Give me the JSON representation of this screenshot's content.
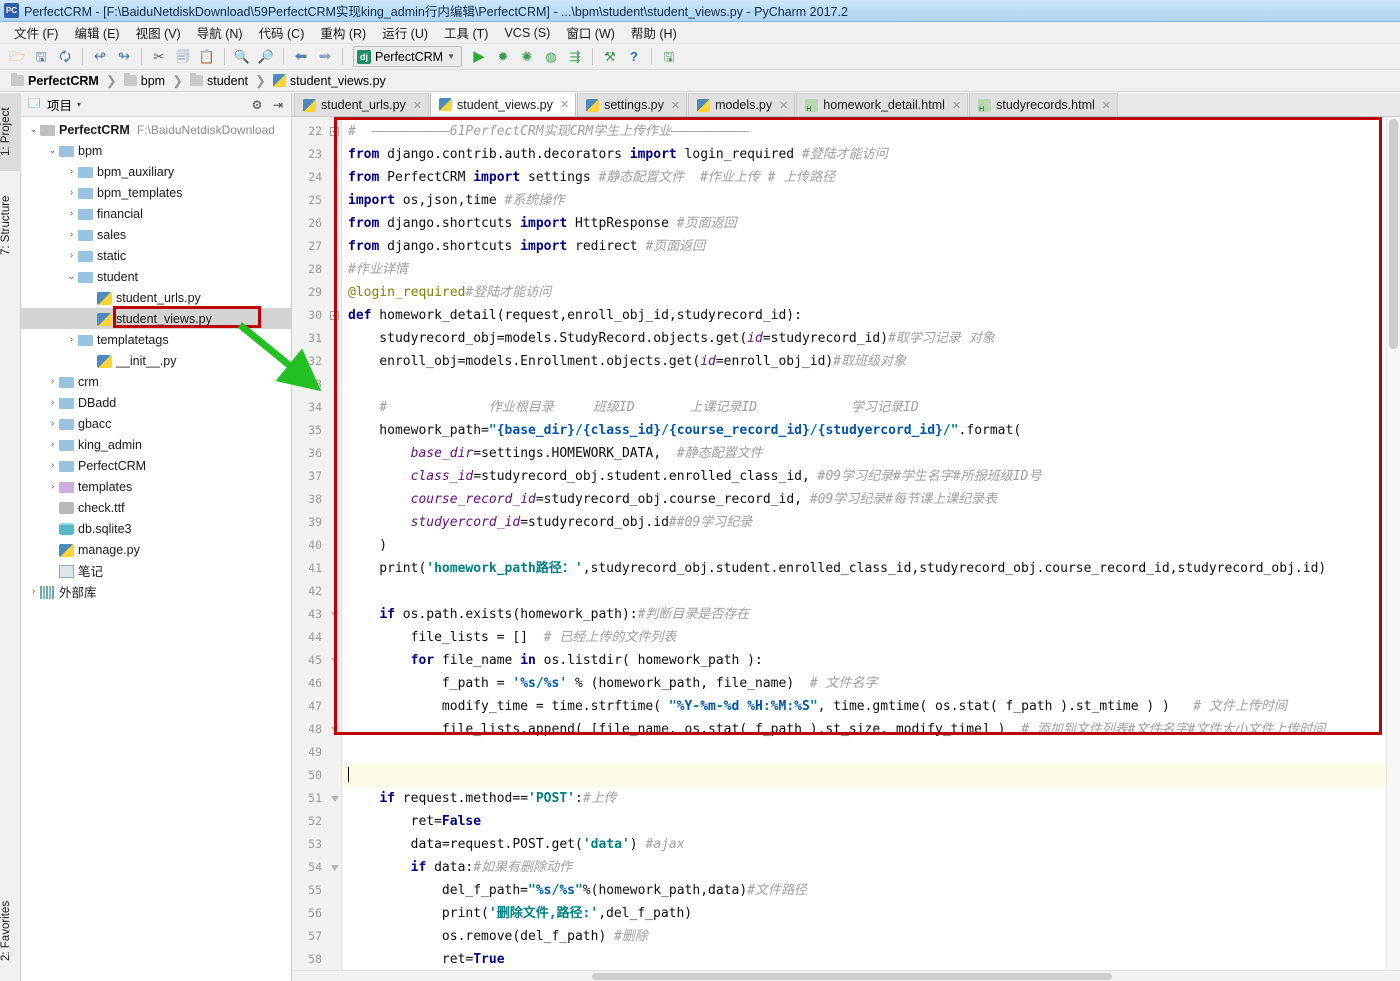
{
  "window": {
    "title": "PerfectCRM - [F:\\BaiduNetdiskDownload\\59PerfectCRM实现king_admin行内编辑\\PerfectCRM] - ...\\bpm\\student\\student_views.py - PyCharm 2017.2",
    "app_badge": "PC"
  },
  "menu": [
    {
      "label": "文件 (F)"
    },
    {
      "label": "编辑 (E)"
    },
    {
      "label": "视图 (V)"
    },
    {
      "label": "导航 (N)"
    },
    {
      "label": "代码 (C)"
    },
    {
      "label": "重构 (R)"
    },
    {
      "label": "运行 (U)"
    },
    {
      "label": "工具 (T)"
    },
    {
      "label": "VCS (S)"
    },
    {
      "label": "窗口 (W)"
    },
    {
      "label": "帮助 (H)"
    }
  ],
  "toolbar": {
    "icons": [
      {
        "name": "open-folder-icon",
        "glyph": "📂"
      },
      {
        "name": "save-all-icon",
        "glyph": "💾"
      },
      {
        "name": "sync-icon",
        "glyph": "🔄"
      },
      {
        "name": "undo-icon",
        "glyph": "↩"
      },
      {
        "name": "redo-icon",
        "glyph": "↪"
      },
      {
        "name": "cut-icon",
        "glyph": "✂"
      },
      {
        "name": "copy-icon",
        "glyph": "⧉"
      },
      {
        "name": "paste-icon",
        "glyph": "📋"
      },
      {
        "name": "find-icon",
        "glyph": "🔍"
      },
      {
        "name": "replace-icon",
        "glyph": "🔎"
      },
      {
        "name": "back-icon",
        "glyph": "⬅"
      },
      {
        "name": "forward-icon",
        "glyph": "➡"
      }
    ],
    "run_config": {
      "label": "PerfectCRM",
      "badge": "dj"
    },
    "run_icons": [
      {
        "name": "run-icon",
        "glyph": "▶",
        "color": "#2eaa37"
      },
      {
        "name": "debug-icon",
        "glyph": "✹",
        "color": "#3c9a4e"
      },
      {
        "name": "coverage-icon",
        "glyph": "✺",
        "color": "#3c9a4e"
      },
      {
        "name": "profile-icon",
        "glyph": "◉",
        "color": "#3c9a4e"
      },
      {
        "name": "attach-icon",
        "glyph": "⇥",
        "color": "#3c9a4e"
      }
    ],
    "extra_icons": [
      {
        "name": "settings-wrench-icon",
        "glyph": "⚒",
        "color": "#3c9a4e"
      },
      {
        "name": "help-icon",
        "glyph": "?",
        "color": "#2b6cb0"
      },
      {
        "name": "database-icon",
        "glyph": "🗄",
        "color": "#3c9a4e"
      }
    ]
  },
  "breadcrumb": [
    {
      "label": "PerfectCRM",
      "icon": "folder-icon",
      "bold": true
    },
    {
      "label": "bpm",
      "icon": "folder-icon",
      "bold": false
    },
    {
      "label": "student",
      "icon": "folder-icon",
      "bold": false
    },
    {
      "label": "student_views.py",
      "icon": "python-file-icon",
      "bold": false
    }
  ],
  "left_strip": [
    {
      "label": "1: Project",
      "active": true,
      "icon": "project-icon"
    },
    {
      "label": "7: Structure",
      "active": false,
      "icon": "structure-icon"
    },
    {
      "label": "2: Favorites",
      "active": false,
      "icon": "star-icon"
    }
  ],
  "project_panel": {
    "header": {
      "title": "项目",
      "dropdown": "▾",
      "gear": "⚙",
      "collapse": "⇥"
    },
    "tree": [
      {
        "depth": 0,
        "arrow": "v",
        "icon": "folder-icon",
        "label": "PerfectCRM",
        "bold": true,
        "path": "F:\\BaiduNetdiskDownload",
        "selected": false
      },
      {
        "depth": 1,
        "arrow": "v",
        "icon": "module-folder-icon",
        "label": "bpm",
        "bold": false,
        "path": "",
        "selected": false
      },
      {
        "depth": 2,
        "arrow": ">",
        "icon": "module-folder-icon",
        "label": "bpm_auxiliary",
        "bold": false,
        "path": "",
        "selected": false
      },
      {
        "depth": 2,
        "arrow": ">",
        "icon": "module-folder-icon",
        "label": "bpm_templates",
        "bold": false,
        "path": "",
        "selected": false
      },
      {
        "depth": 2,
        "arrow": ">",
        "icon": "module-folder-icon",
        "label": "financial",
        "bold": false,
        "path": "",
        "selected": false
      },
      {
        "depth": 2,
        "arrow": ">",
        "icon": "module-folder-icon",
        "label": "sales",
        "bold": false,
        "path": "",
        "selected": false
      },
      {
        "depth": 2,
        "arrow": ">",
        "icon": "module-folder-icon",
        "label": "static",
        "bold": false,
        "path": "",
        "selected": false
      },
      {
        "depth": 2,
        "arrow": "v",
        "icon": "module-folder-icon",
        "label": "student",
        "bold": false,
        "path": "",
        "selected": false
      },
      {
        "depth": 3,
        "arrow": "",
        "icon": "python-file-icon",
        "label": "student_urls.py",
        "bold": false,
        "path": "",
        "selected": false
      },
      {
        "depth": 3,
        "arrow": "",
        "icon": "python-file-icon",
        "label": "student_views.py",
        "bold": false,
        "path": "",
        "selected": true
      },
      {
        "depth": 2,
        "arrow": ">",
        "icon": "module-folder-icon",
        "label": "templatetags",
        "bold": false,
        "path": "",
        "selected": false
      },
      {
        "depth": 3,
        "arrow": "",
        "icon": "python-file-icon",
        "label": "__init__.py",
        "bold": false,
        "path": "",
        "selected": false
      },
      {
        "depth": 1,
        "arrow": ">",
        "icon": "module-folder-icon",
        "label": "crm",
        "bold": false,
        "path": "",
        "selected": false
      },
      {
        "depth": 1,
        "arrow": ">",
        "icon": "module-folder-icon",
        "label": "DBadd",
        "bold": false,
        "path": "",
        "selected": false
      },
      {
        "depth": 1,
        "arrow": ">",
        "icon": "module-folder-icon",
        "label": "gbacc",
        "bold": false,
        "path": "",
        "selected": false
      },
      {
        "depth": 1,
        "arrow": ">",
        "icon": "module-folder-icon",
        "label": "king_admin",
        "bold": false,
        "path": "",
        "selected": false
      },
      {
        "depth": 1,
        "arrow": ">",
        "icon": "module-folder-icon",
        "label": "PerfectCRM",
        "bold": false,
        "path": "",
        "selected": false
      },
      {
        "depth": 1,
        "arrow": ">",
        "icon": "templates-folder-icon",
        "label": "templates",
        "bold": false,
        "path": "",
        "selected": false
      },
      {
        "depth": 1,
        "arrow": "",
        "icon": "ttf-file-icon",
        "label": "check.ttf",
        "bold": false,
        "path": "",
        "selected": false
      },
      {
        "depth": 1,
        "arrow": "",
        "icon": "sqlite-file-icon",
        "label": "db.sqlite3",
        "bold": false,
        "path": "",
        "selected": false
      },
      {
        "depth": 1,
        "arrow": "",
        "icon": "python-file-icon",
        "label": "manage.py",
        "bold": false,
        "path": "",
        "selected": false
      },
      {
        "depth": 1,
        "arrow": "",
        "icon": "note-file-icon",
        "label": "笔记",
        "bold": false,
        "path": "",
        "selected": false
      },
      {
        "depth": 0,
        "arrow": ">",
        "icon": "external-library-icon",
        "label": "外部库",
        "bold": false,
        "path": "",
        "selected": false
      }
    ]
  },
  "editor_tabs": [
    {
      "label": "student_urls.py",
      "icon": "python-file-icon",
      "active": false
    },
    {
      "label": "student_views.py",
      "icon": "python-file-icon",
      "active": true
    },
    {
      "label": "settings.py",
      "icon": "python-file-icon",
      "active": false
    },
    {
      "label": "models.py",
      "icon": "python-file-icon",
      "active": false
    },
    {
      "label": "homework_detail.html",
      "icon": "html-file-icon",
      "active": false
    },
    {
      "label": "studyrecords.html",
      "icon": "html-file-icon",
      "active": false
    }
  ],
  "editor": {
    "first_line_number": 22,
    "caret_line_number": 50,
    "lines": [
      {
        "n": 22,
        "fold": "minus",
        "html": "<span class=\"cm\">#  ——————————61PerfectCRM实现CRM学生上传作业——————————</span>"
      },
      {
        "n": 23,
        "fold": "",
        "html": "<span class=\"kw\">from</span> django.contrib.auth.decorators <span class=\"kw\">import</span> login_required <span class=\"cm\">#登陆才能访问</span>"
      },
      {
        "n": 24,
        "fold": "",
        "html": "<span class=\"kw\">from</span> PerfectCRM <span class=\"kw\">import</span> settings <span class=\"cm\">#静态配置文件  #作业上传 # 上传路径</span>"
      },
      {
        "n": 25,
        "fold": "",
        "html": "<span class=\"kw\">import</span> os,json,time <span class=\"cm\">#系统操作</span>"
      },
      {
        "n": 26,
        "fold": "",
        "html": "<span class=\"kw\">from</span> django.shortcuts <span class=\"kw\">import</span> HttpResponse <span class=\"cm\">#页面返回</span>"
      },
      {
        "n": 27,
        "fold": "",
        "html": "<span class=\"kw\">from</span> django.shortcuts <span class=\"kw\">import</span> redirect <span class=\"cm\">#页面返回</span>"
      },
      {
        "n": 28,
        "fold": "",
        "html": "<span class=\"cm\">#作业详情</span>"
      },
      {
        "n": 29,
        "fold": "",
        "html": "<span class=\"deco\">@login_required</span><span class=\"cm\">#登陆才能访问</span>"
      },
      {
        "n": 30,
        "fold": "minus",
        "html": "<span class=\"kw\">def</span> homework_detail(request,enroll_obj_id,studyrecord_id):"
      },
      {
        "n": 31,
        "fold": "",
        "html": "    studyrecord_obj=models.StudyRecord.objects.get(<span class=\"kwarg\">id</span>=studyrecord_id)<span class=\"cm\">#取学习记录 对象</span>"
      },
      {
        "n": 32,
        "fold": "",
        "html": "    enroll_obj=models.Enrollment.objects.get(<span class=\"kwarg\">id</span>=enroll_obj_id)<span class=\"cm\">#取班级对象</span>"
      },
      {
        "n": 33,
        "fold": "",
        "html": ""
      },
      {
        "n": 34,
        "fold": "",
        "html": "    <span class=\"cm\">#             作业根目录     班级ID       上课记录ID            学习记录ID</span>"
      },
      {
        "n": 35,
        "fold": "",
        "html": "    homework_path=<span class=\"str\">\"</span><span class=\"fmt\">{base_dir}</span><span class=\"str\">/</span><span class=\"fmt\">{class_id}</span><span class=\"str\">/</span><span class=\"fmt\">{course_record_id}</span><span class=\"str\">/</span><span class=\"fmt\">{studyercord_id}</span><span class=\"str\">/\"</span>.format("
      },
      {
        "n": 36,
        "fold": "",
        "html": "        <span class=\"kwarg\">base_dir</span>=settings.HOMEWORK_DATA,  <span class=\"cm\">#静态配置文件</span>"
      },
      {
        "n": 37,
        "fold": "",
        "html": "        <span class=\"kwarg\">class_id</span>=studyrecord_obj.student.enrolled_class_id, <span class=\"cm\">#09学习纪录#学生名字#所报班级ID号</span>"
      },
      {
        "n": 38,
        "fold": "",
        "html": "        <span class=\"kwarg\">course_record_id</span>=studyrecord_obj.course_record_id, <span class=\"cm\">#09学习纪录#每节课上课纪录表</span>"
      },
      {
        "n": 39,
        "fold": "",
        "html": "        <span class=\"kwarg\">studyercord_id</span>=studyrecord_obj.id<span class=\"cm\">##09学习纪录</span>"
      },
      {
        "n": 40,
        "fold": "",
        "html": "    )"
      },
      {
        "n": 41,
        "fold": "",
        "html": "    print(<span class=\"str\">'homework_path路径：'</span>,studyrecord_obj.student.enrolled_class_id,studyrecord_obj.course_record_id,studyrecord_obj.id)"
      },
      {
        "n": 42,
        "fold": "",
        "html": ""
      },
      {
        "n": 43,
        "fold": "tri",
        "html": "    <span class=\"kw\">if</span> os.path.exists(homework_path):<span class=\"cm\">#判断目录是否存在</span>"
      },
      {
        "n": 44,
        "fold": "",
        "html": "        file_lists = []  <span class=\"cm\"># 已经上传的文件列表</span>"
      },
      {
        "n": 45,
        "fold": "tri",
        "html": "        <span class=\"kw\">for</span> file_name <span class=\"kw\">in</span> os.listdir( homework_path ):"
      },
      {
        "n": 46,
        "fold": "",
        "html": "            f_path = <span class=\"str\">'</span><span class=\"fmt\">%s</span><span class=\"str\">/</span><span class=\"fmt\">%s</span><span class=\"str\">'</span> % (homework_path, file_name)  <span class=\"cm\"># 文件名字</span>"
      },
      {
        "n": 47,
        "fold": "",
        "html": "            modify_time = time.strftime( <span class=\"str\">\"</span><span class=\"fmt\">%Y</span><span class=\"str\">-</span><span class=\"fmt\">%m</span><span class=\"str\">-</span><span class=\"fmt\">%d</span><span class=\"str\"> </span><span class=\"fmt\">%H</span><span class=\"str\">:</span><span class=\"fmt\">%M</span><span class=\"str\">:</span><span class=\"fmt\">%S</span><span class=\"str\">\"</span>, time.gmtime( os.stat( f_path ).st_mtime ) )   <span class=\"cm\"># 文件上传时间</span>"
      },
      {
        "n": 48,
        "fold": "tri",
        "html": "            file_lists.append( [file_name, os.stat( f_path ).st_size, modify_time] )  <span class=\"cm\"># 添加到文件列表#文件名字#文件大小文件上传时间</span>"
      },
      {
        "n": 49,
        "fold": "",
        "html": ""
      },
      {
        "n": 50,
        "fold": "",
        "html": "",
        "caret": true
      },
      {
        "n": 51,
        "fold": "tri",
        "html": "    <span class=\"kw\">if</span> request.method==<span class=\"str\">'POST'</span>:<span class=\"cm\">#上传</span>"
      },
      {
        "n": 52,
        "fold": "",
        "html": "        ret=<span class=\"kw\">False</span>"
      },
      {
        "n": 53,
        "fold": "",
        "html": "        data=request.POST.get(<span class=\"str\">'data'</span>) <span class=\"cm\">#ajax</span>"
      },
      {
        "n": 54,
        "fold": "tri",
        "html": "        <span class=\"kw\">if</span> data:<span class=\"cm\">#如果有删除动作</span>"
      },
      {
        "n": 55,
        "fold": "",
        "html": "            del_f_path=<span class=\"str\">\"</span><span class=\"fmt\">%s</span><span class=\"str\">/</span><span class=\"fmt\">%s</span><span class=\"str\">\"</span>%(homework_path,data)<span class=\"cm\">#文件路径</span>"
      },
      {
        "n": 56,
        "fold": "",
        "html": "            print(<span class=\"str\">'删除文件,路径:'</span>,del_f_path)"
      },
      {
        "n": 57,
        "fold": "",
        "html": "            os.remove(del_f_path) <span class=\"cm\">#删除</span>"
      },
      {
        "n": 58,
        "fold": "",
        "html": "            ret=<span class=\"kw\">True</span>"
      }
    ]
  },
  "annotations": {
    "highlight_color": "#c00000",
    "arrow_color": "#22c022",
    "file_highlight_label": "student_views.py",
    "code_highlight_lines": "22-48"
  }
}
